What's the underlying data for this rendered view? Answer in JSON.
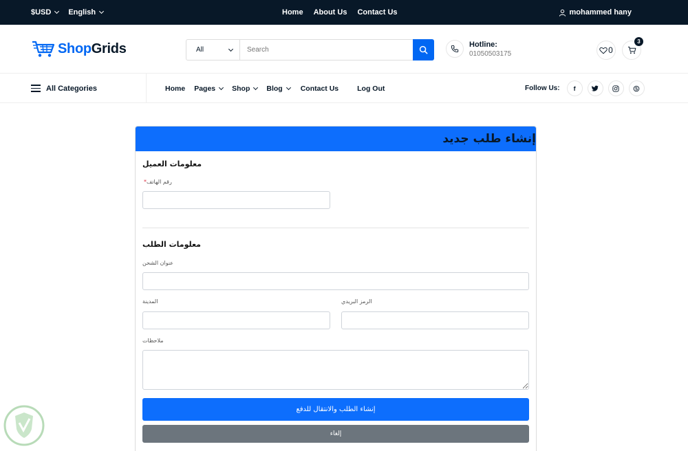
{
  "topbar": {
    "currency": "$USD",
    "language": "English",
    "links": [
      "Home",
      "About Us",
      "Contact Us"
    ],
    "user_name": "mohammed hany"
  },
  "header": {
    "logo_part1": "Shop",
    "logo_part2": "Grids",
    "search_category": "All",
    "search_placeholder": "Search",
    "hotline_label": "Hotline:",
    "hotline_number": "01050503175",
    "wishlist_count": "0",
    "cart_count": "3"
  },
  "nav": {
    "all_categories": "All Categories",
    "items": [
      "Home",
      "Pages",
      "Shop",
      "Blog",
      "Contact Us",
      "Log Out"
    ],
    "follow_label": "Follow Us:"
  },
  "form": {
    "title": "إنشاء طلب جديد",
    "customer_section": "معلومات العميل",
    "phone_label": "رقم الهاتف",
    "phone_required_mark": "*",
    "order_section": "معلومات الطلب",
    "shipping_address_label": "عنوان الشحن",
    "city_label": "المدينة",
    "postal_code_label": "الرمز البريدي",
    "notes_label": "ملاحظات",
    "submit_label": "إنشاء الطلب والانتقال للدفع",
    "cancel_label": "إلغاء"
  },
  "colors": {
    "dark": "#081828",
    "brand": "#0167f3",
    "primary": "#0d6efd",
    "secondary": "#6c757d"
  }
}
